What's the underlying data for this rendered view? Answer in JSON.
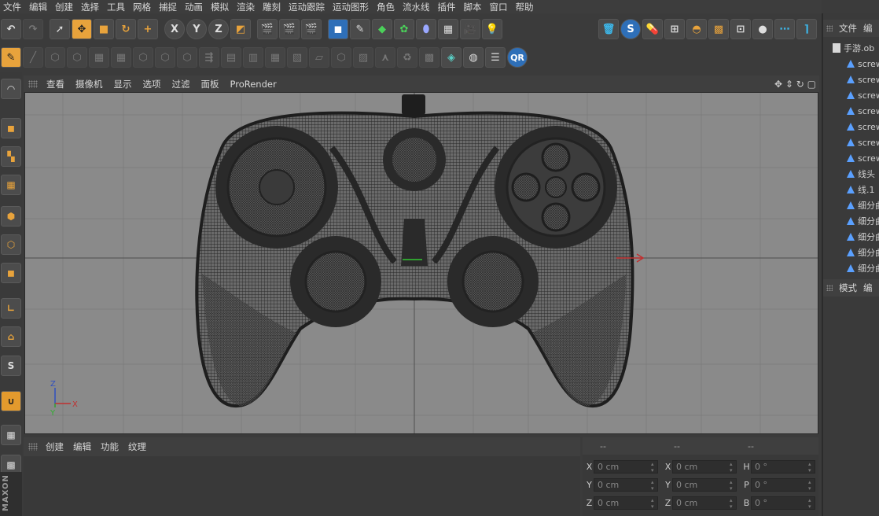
{
  "menu": [
    "文件",
    "编辑",
    "创建",
    "选择",
    "工具",
    "网格",
    "捕捉",
    "动画",
    "模拟",
    "渲染",
    "雕刻",
    "运动跟踪",
    "运动图形",
    "角色",
    "流水线",
    "插件",
    "脚本",
    "窗口",
    "帮助"
  ],
  "toolbar": {
    "undo_icon": "undo-icon",
    "axis_x": "X",
    "axis_y": "Y",
    "axis_z": "Z",
    "right_s": "S",
    "qr": "QR"
  },
  "leftbar": {
    "s_label": "S"
  },
  "viewport": {
    "menu": [
      "查看",
      "摄像机",
      "显示",
      "选项",
      "过滤",
      "面板",
      "ProRender"
    ],
    "axis_labels": {
      "z": "Z",
      "y": "Y",
      "x": "X"
    }
  },
  "objects": {
    "tabs": [
      "文件",
      "编"
    ],
    "root": "手游.ob",
    "items": [
      "screw",
      "screw",
      "screw",
      "screw",
      "screw",
      "screw",
      "screw",
      "线头",
      "线.1",
      "细分曲",
      "细分曲",
      "细分曲",
      "细分曲",
      "细分曲"
    ]
  },
  "attributes": {
    "tabs": [
      "模式",
      "编"
    ]
  },
  "timeline": {
    "menu": [
      "创建",
      "编辑",
      "功能",
      "纹理"
    ]
  },
  "coordinates": {
    "headers": [
      "--",
      "--",
      "--"
    ],
    "rows": [
      {
        "a": "X",
        "av": "0 cm",
        "b": "X",
        "bv": "0 cm",
        "c": "H",
        "cv": "0 °"
      },
      {
        "a": "Y",
        "av": "0 cm",
        "b": "Y",
        "bv": "0 cm",
        "c": "P",
        "cv": "0 °"
      },
      {
        "a": "Z",
        "av": "0 cm",
        "b": "Z",
        "bv": "0 cm",
        "c": "B",
        "cv": "0 °"
      }
    ]
  },
  "brand": "MAXON CINEMA"
}
